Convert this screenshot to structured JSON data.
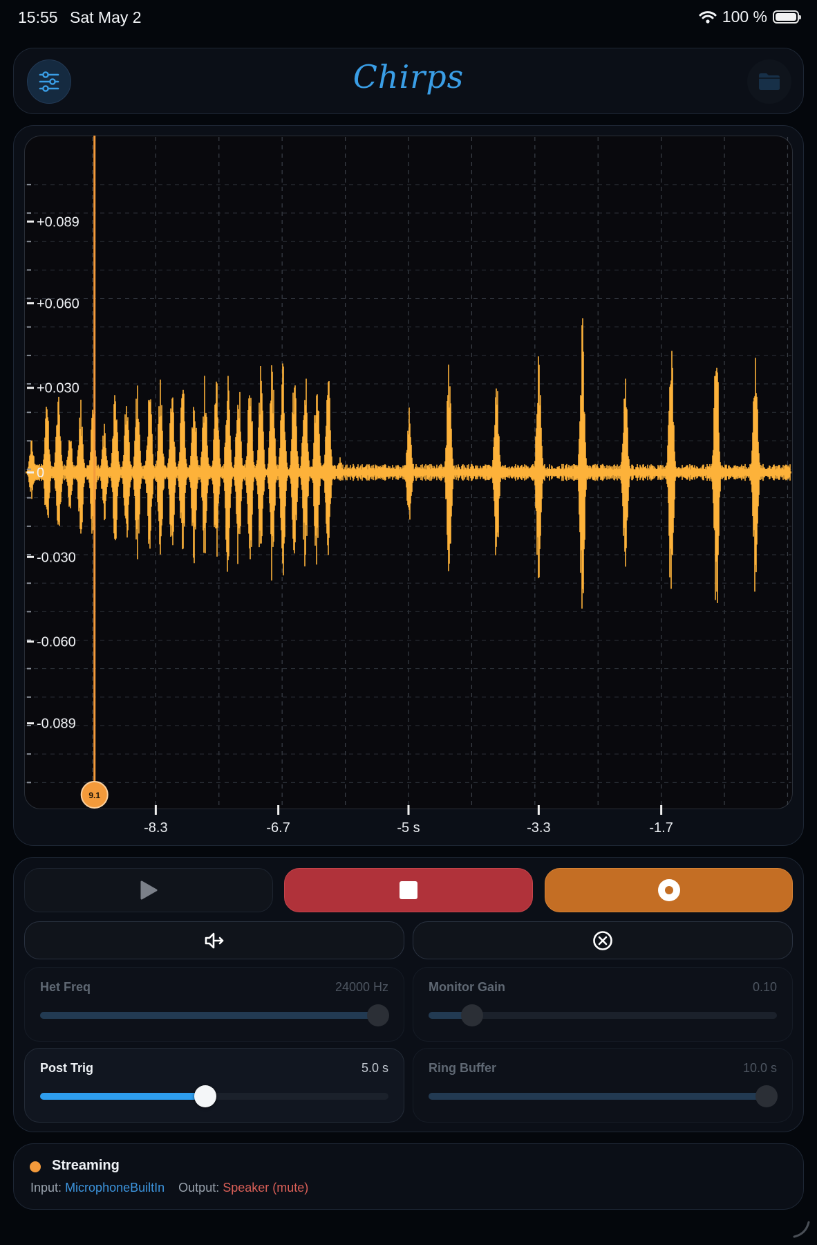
{
  "status_bar": {
    "time": "15:55",
    "date": "Sat May 2",
    "battery": "100 %"
  },
  "header": {
    "title": "Chirps",
    "settings_icon": "sliders-icon",
    "folder_icon": "folder-icon"
  },
  "colors": {
    "waveform": "#fdb23a",
    "cursor": "#f39a3b",
    "accent": "#2e9ded",
    "stop": "#b0323a",
    "record": "#c46e24",
    "background": "#04070c"
  },
  "chart_data": {
    "type": "line",
    "grid": true,
    "xlim": [
      -10.0,
      0.0
    ],
    "ylim": [
      -0.119,
      0.119
    ],
    "x_ticks": [
      -8.3,
      -6.7,
      -5,
      -3.3,
      -1.7
    ],
    "x_tick_labels": [
      "-8.3",
      "-6.7",
      "-5 s",
      "-3.3",
      "-1.7"
    ],
    "y_ticks": [
      0.089,
      0.06,
      0.03,
      0,
      -0.03,
      -0.06,
      -0.089
    ],
    "y_tick_labels": [
      "+0.089",
      "+0.060",
      "+0.030",
      "0",
      "-0.030",
      "-0.060",
      "-0.089"
    ],
    "cursor": {
      "x": -9.1,
      "label": "9.1"
    },
    "series": [
      {
        "peaks_x": [
          -9.92,
          -9.72,
          -9.57,
          -9.42,
          -9.28,
          -9.12,
          -8.97,
          -8.83,
          -8.68,
          -8.54,
          -8.38,
          -8.24,
          -8.09,
          -7.95,
          -7.8,
          -7.66,
          -7.51,
          -7.36,
          -7.22,
          -7.07,
          -6.93,
          -6.78,
          -6.64,
          -6.49,
          -6.35,
          -6.2,
          -6.05,
          -5.9,
          -4.99,
          -4.47,
          -3.85,
          -3.3,
          -2.73,
          -2.17,
          -1.57,
          -0.98,
          -0.47
        ],
        "peaks_top": [
          0.012,
          0.026,
          0.032,
          0.015,
          0.026,
          0.028,
          0.018,
          0.031,
          0.03,
          0.033,
          0.032,
          0.033,
          0.034,
          0.036,
          0.034,
          0.035,
          0.036,
          0.039,
          0.037,
          0.04,
          0.039,
          0.041,
          0.04,
          0.038,
          0.04,
          0.039,
          0.039,
          0.006,
          0.025,
          0.042,
          0.036,
          0.046,
          0.057,
          0.038,
          0.053,
          0.052,
          0.045
        ],
        "peaks_bottom": [
          -0.01,
          -0.022,
          -0.028,
          -0.014,
          -0.025,
          -0.028,
          -0.02,
          -0.028,
          -0.03,
          -0.032,
          -0.03,
          -0.033,
          -0.034,
          -0.034,
          -0.034,
          -0.034,
          -0.035,
          -0.038,
          -0.036,
          -0.039,
          -0.038,
          -0.04,
          -0.038,
          -0.034,
          -0.036,
          -0.036,
          -0.036,
          -0.003,
          -0.02,
          -0.042,
          -0.036,
          -0.046,
          -0.058,
          -0.04,
          -0.05,
          -0.055,
          -0.047
        ],
        "noise_level": 0.002
      }
    ]
  },
  "controls": {
    "play_icon": "play-icon",
    "stop_icon": "stop-icon",
    "record_icon": "record-icon",
    "monitor_icon": "speaker-arrow-icon",
    "clear_icon": "circle-x-icon"
  },
  "sliders": [
    {
      "key": "het",
      "label": "Het Freq",
      "value": "24000 Hz",
      "fraction": 0.97,
      "active": false
    },
    {
      "key": "gain",
      "label": "Monitor Gain",
      "value": "0.10",
      "fraction": 0.125,
      "active": false
    },
    {
      "key": "posttrig",
      "label": "Post Trig",
      "value": "5.0 s",
      "fraction": 0.475,
      "active": true
    },
    {
      "key": "ring",
      "label": "Ring Buffer",
      "value": "10.0 s",
      "fraction": 0.97,
      "active": false
    }
  ],
  "status": {
    "state": "Streaming",
    "input_label": "Input:",
    "input_value": "MicrophoneBuiltIn",
    "output_label": "Output:",
    "output_value": "Speaker (mute)"
  }
}
